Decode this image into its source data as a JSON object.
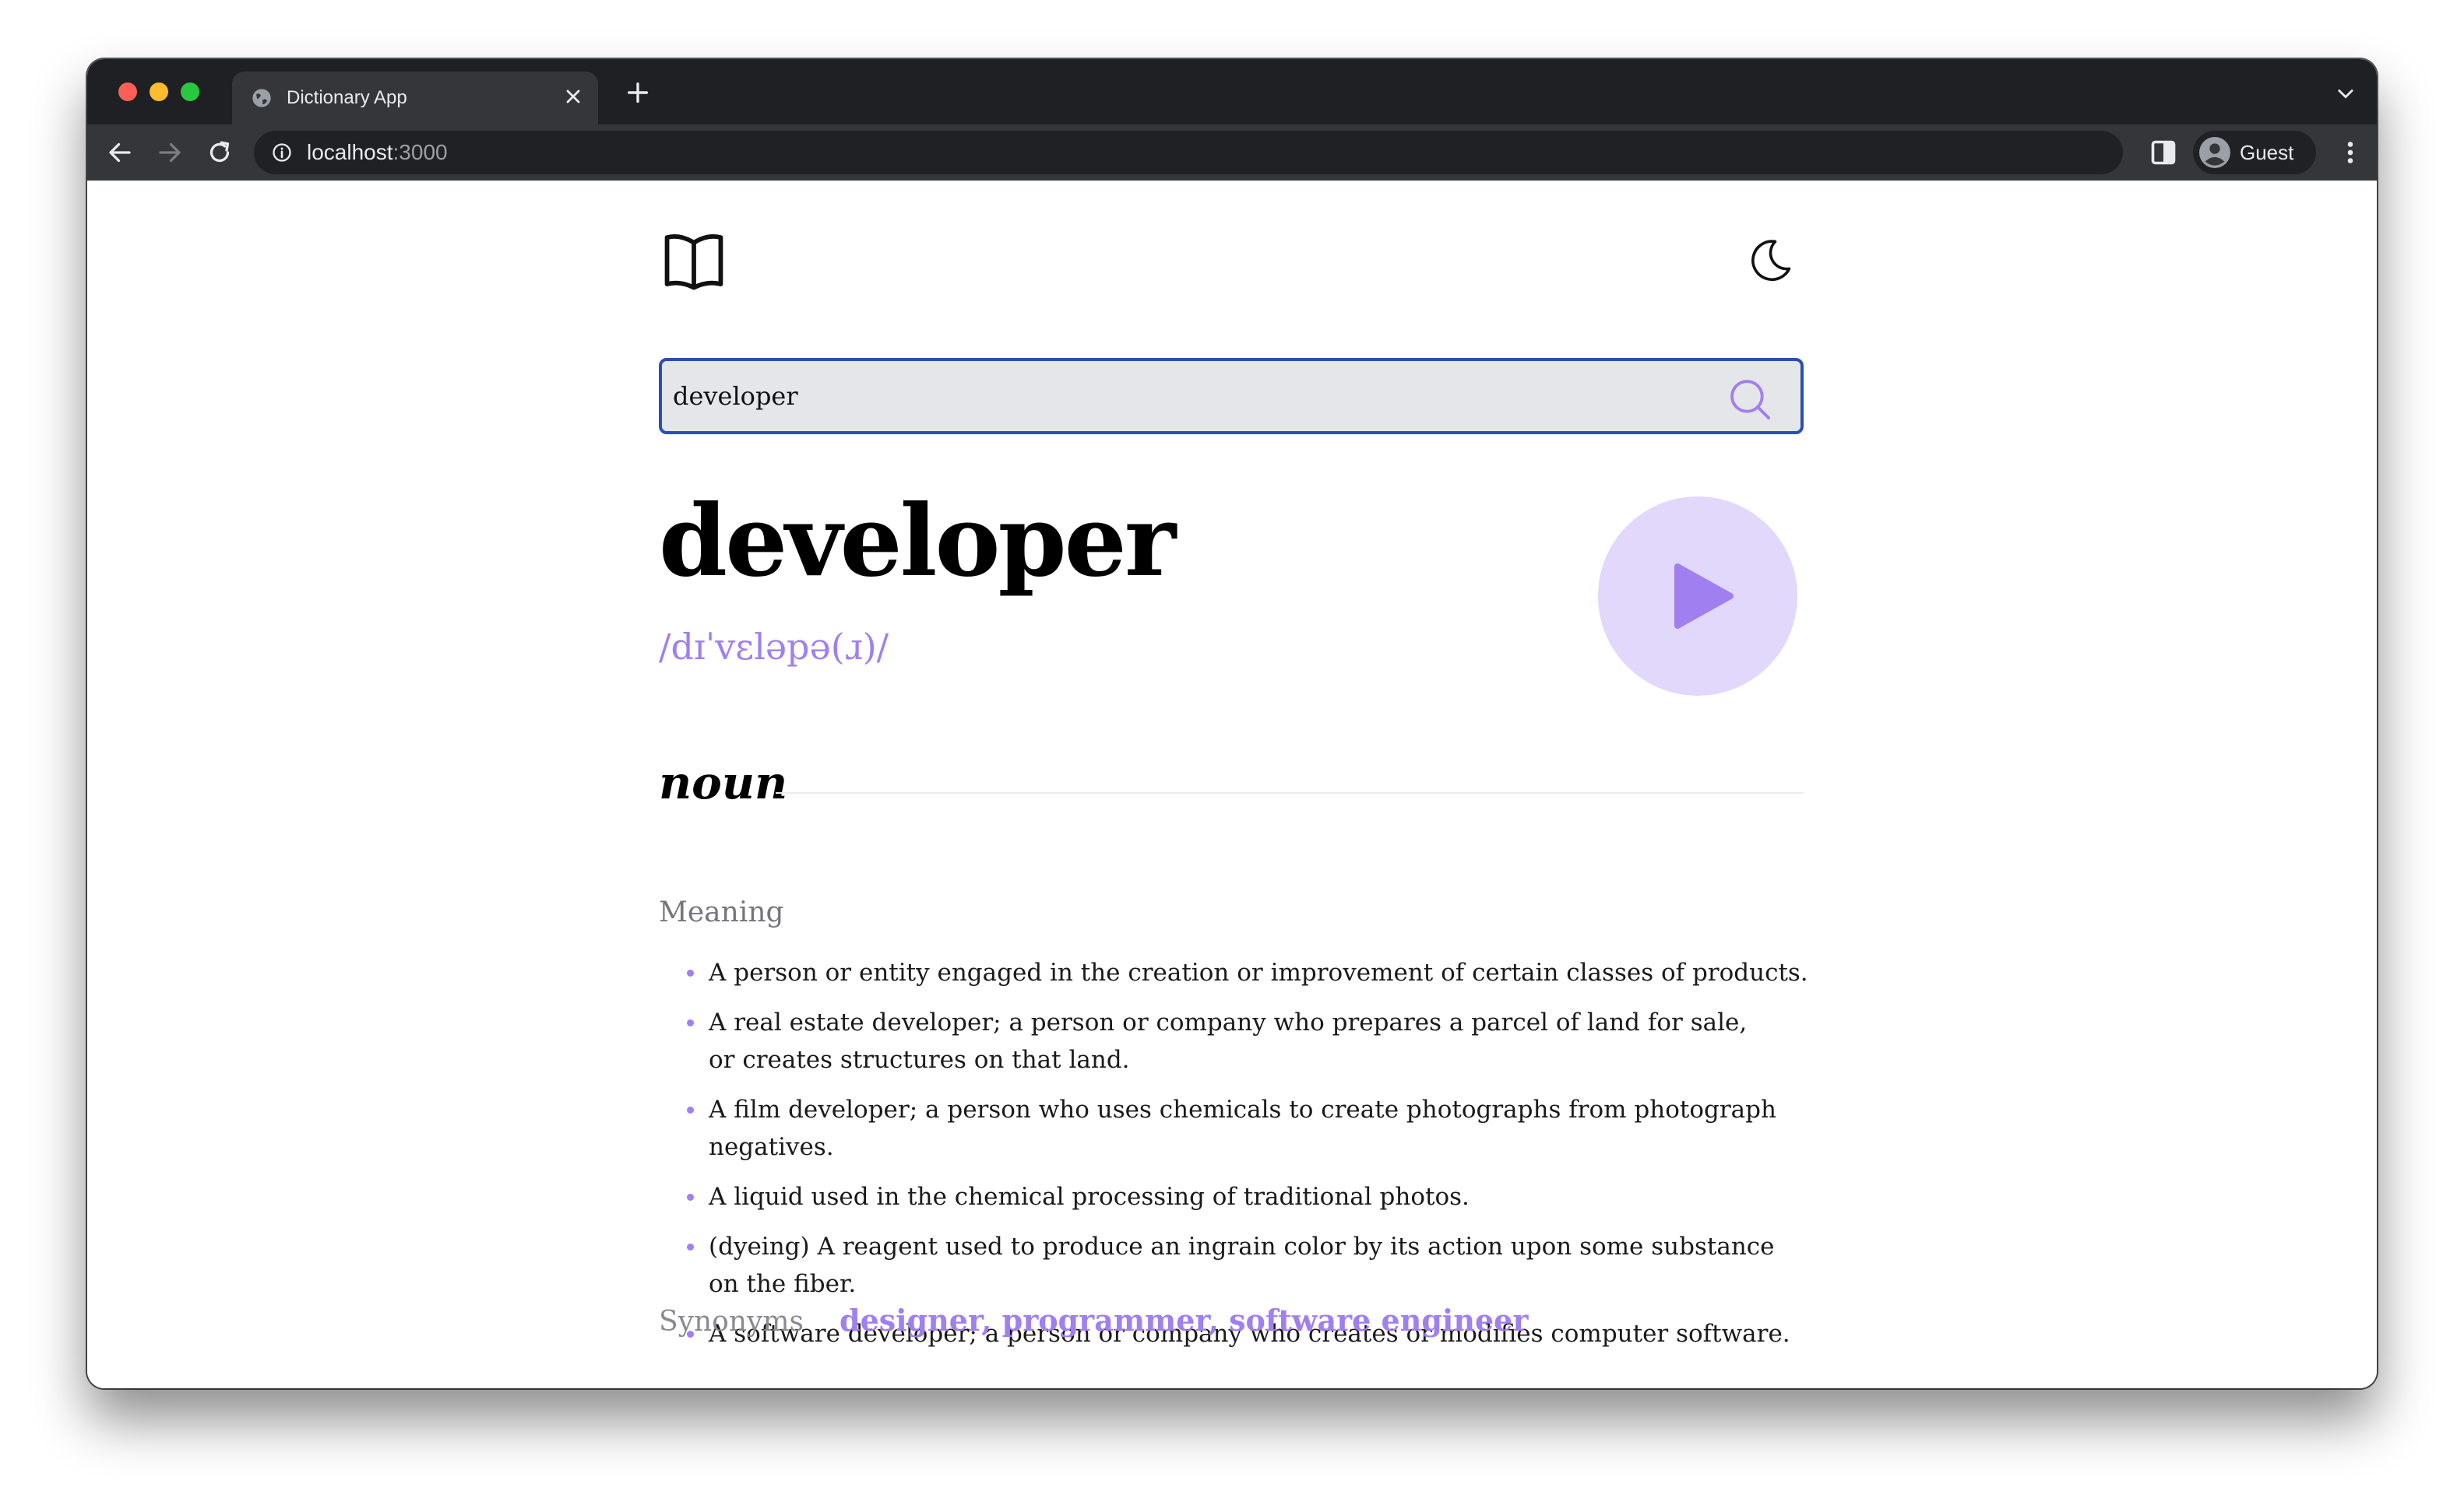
{
  "browser": {
    "tab_title": "Dictionary App",
    "url_host": "localhost",
    "url_port": ":3000",
    "profile_name": "Guest"
  },
  "app": {
    "search_value": "developer",
    "word": "developer",
    "phonetic": "/dɪˈvɛləpə(ɹ)/",
    "part_of_speech": "noun",
    "meaning_label": "Meaning",
    "definitions": [
      "A person or entity engaged in the creation or improvement of certain classes of products.",
      "A real estate developer; a person or company who prepares a parcel of land for sale, or creates structures on that land.",
      "A film developer; a person who uses chemicals to create photographs from photograph negatives.",
      "A liquid used in the chemical processing of traditional photos.",
      "(dyeing) A reagent used to produce an ingrain color by its action upon some substance on the fiber.",
      "A software developer; a person or company who creates or modifies computer software."
    ],
    "synonyms_label": "Synonyms",
    "synonyms": "designer, programmer, software engineer"
  },
  "colors": {
    "accent": "#a07ff0",
    "play_bg": "#e1d8fb",
    "search_border": "#2a4fb3",
    "search_bg": "#e5e6ea"
  },
  "icons": [
    "globe-icon",
    "close-icon",
    "plus-icon",
    "chevron-down-icon",
    "back-arrow-icon",
    "forward-arrow-icon",
    "reload-icon",
    "info-icon",
    "side-panel-icon",
    "profile-avatar-icon",
    "kebab-menu-icon",
    "book-icon",
    "moon-icon",
    "search-icon",
    "play-icon"
  ]
}
